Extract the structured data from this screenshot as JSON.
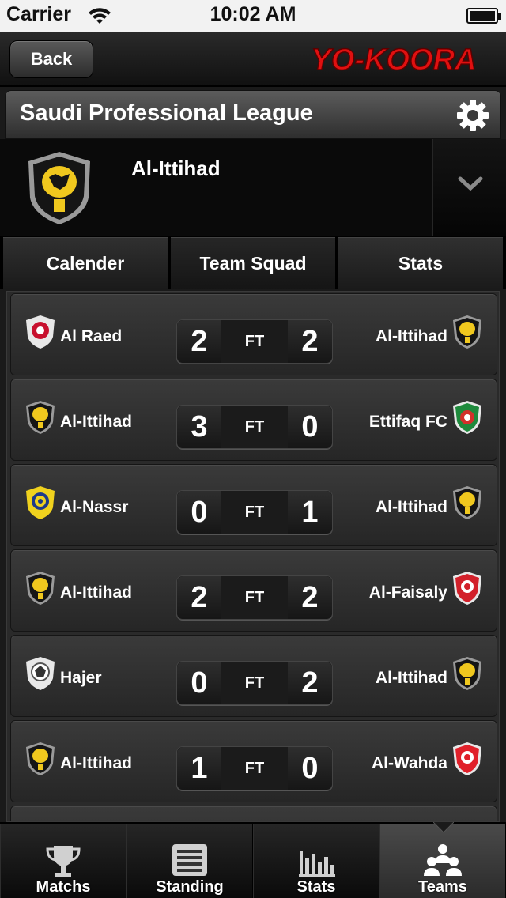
{
  "status_bar": {
    "carrier": "Carrier",
    "time": "10:02 AM"
  },
  "nav": {
    "back_label": "Back",
    "logo_text": "YO-KOORA"
  },
  "league": {
    "title": "Saudi Professional League"
  },
  "team": {
    "name": "Al-Ittihad"
  },
  "tabs": [
    {
      "label": "Calender"
    },
    {
      "label": "Team Squad"
    },
    {
      "label": "Stats"
    }
  ],
  "matches": [
    {
      "home": "Al Raed",
      "home_score": "2",
      "status": "FT",
      "away_score": "2",
      "away": "Al-Ittihad"
    },
    {
      "home": "Al-Ittihad",
      "home_score": "3",
      "status": "FT",
      "away_score": "0",
      "away": "Ettifaq FC"
    },
    {
      "home": "Al-Nassr",
      "home_score": "0",
      "status": "FT",
      "away_score": "1",
      "away": "Al-Ittihad"
    },
    {
      "home": "Al-Ittihad",
      "home_score": "2",
      "status": "FT",
      "away_score": "2",
      "away": "Al-Faisaly"
    },
    {
      "home": "Hajer",
      "home_score": "0",
      "status": "FT",
      "away_score": "2",
      "away": "Al-Ittihad"
    },
    {
      "home": "Al-Ittihad",
      "home_score": "1",
      "status": "FT",
      "away_score": "0",
      "away": "Al-Wahda"
    }
  ],
  "tab_bar": [
    {
      "label": "Matchs",
      "icon": "trophy-icon"
    },
    {
      "label": "Standing",
      "icon": "list-icon"
    },
    {
      "label": "Stats",
      "icon": "bar-chart-icon"
    },
    {
      "label": "Teams",
      "icon": "teams-icon"
    }
  ],
  "colors": {
    "logo_red": "#e01010",
    "ittihad_yellow": "#f0c81e"
  }
}
